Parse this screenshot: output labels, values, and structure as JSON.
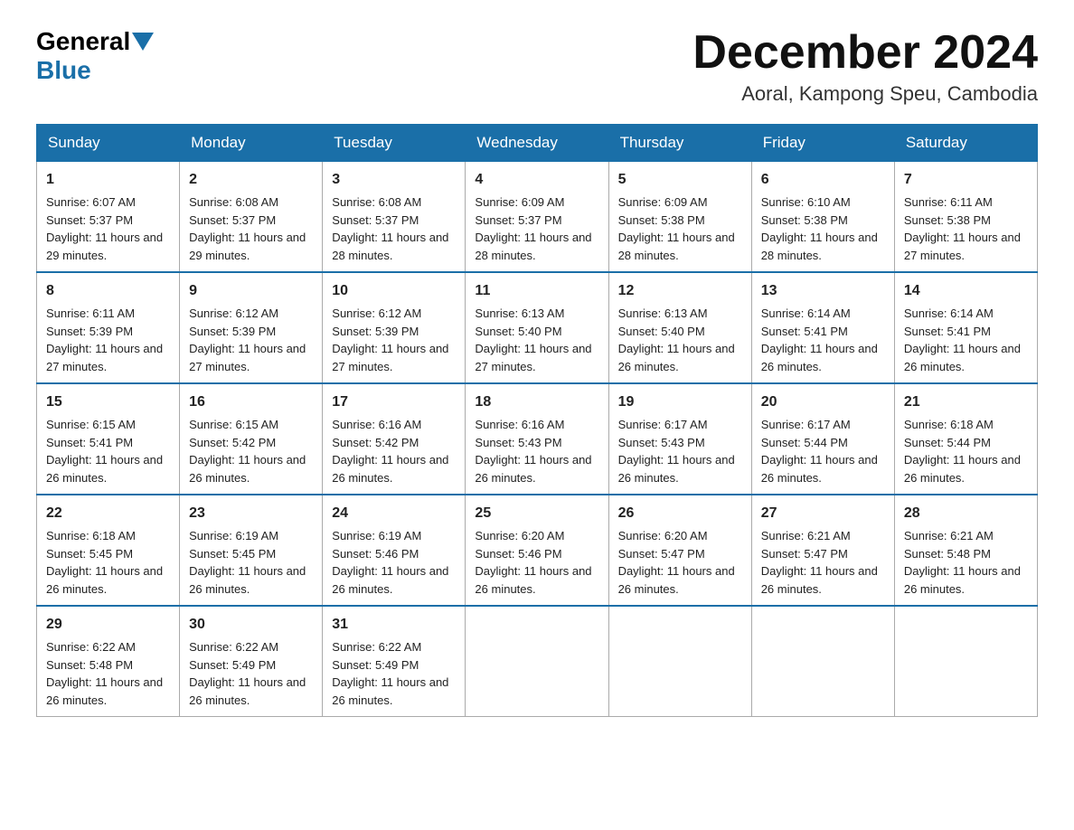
{
  "header": {
    "logo_general": "General",
    "logo_blue": "Blue",
    "month_year": "December 2024",
    "location": "Aoral, Kampong Speu, Cambodia"
  },
  "days_of_week": [
    "Sunday",
    "Monday",
    "Tuesday",
    "Wednesday",
    "Thursday",
    "Friday",
    "Saturday"
  ],
  "weeks": [
    [
      {
        "day": "1",
        "sunrise": "6:07 AM",
        "sunset": "5:37 PM",
        "daylight": "11 hours and 29 minutes."
      },
      {
        "day": "2",
        "sunrise": "6:08 AM",
        "sunset": "5:37 PM",
        "daylight": "11 hours and 29 minutes."
      },
      {
        "day": "3",
        "sunrise": "6:08 AM",
        "sunset": "5:37 PM",
        "daylight": "11 hours and 28 minutes."
      },
      {
        "day": "4",
        "sunrise": "6:09 AM",
        "sunset": "5:37 PM",
        "daylight": "11 hours and 28 minutes."
      },
      {
        "day": "5",
        "sunrise": "6:09 AM",
        "sunset": "5:38 PM",
        "daylight": "11 hours and 28 minutes."
      },
      {
        "day": "6",
        "sunrise": "6:10 AM",
        "sunset": "5:38 PM",
        "daylight": "11 hours and 28 minutes."
      },
      {
        "day": "7",
        "sunrise": "6:11 AM",
        "sunset": "5:38 PM",
        "daylight": "11 hours and 27 minutes."
      }
    ],
    [
      {
        "day": "8",
        "sunrise": "6:11 AM",
        "sunset": "5:39 PM",
        "daylight": "11 hours and 27 minutes."
      },
      {
        "day": "9",
        "sunrise": "6:12 AM",
        "sunset": "5:39 PM",
        "daylight": "11 hours and 27 minutes."
      },
      {
        "day": "10",
        "sunrise": "6:12 AM",
        "sunset": "5:39 PM",
        "daylight": "11 hours and 27 minutes."
      },
      {
        "day": "11",
        "sunrise": "6:13 AM",
        "sunset": "5:40 PM",
        "daylight": "11 hours and 27 minutes."
      },
      {
        "day": "12",
        "sunrise": "6:13 AM",
        "sunset": "5:40 PM",
        "daylight": "11 hours and 26 minutes."
      },
      {
        "day": "13",
        "sunrise": "6:14 AM",
        "sunset": "5:41 PM",
        "daylight": "11 hours and 26 minutes."
      },
      {
        "day": "14",
        "sunrise": "6:14 AM",
        "sunset": "5:41 PM",
        "daylight": "11 hours and 26 minutes."
      }
    ],
    [
      {
        "day": "15",
        "sunrise": "6:15 AM",
        "sunset": "5:41 PM",
        "daylight": "11 hours and 26 minutes."
      },
      {
        "day": "16",
        "sunrise": "6:15 AM",
        "sunset": "5:42 PM",
        "daylight": "11 hours and 26 minutes."
      },
      {
        "day": "17",
        "sunrise": "6:16 AM",
        "sunset": "5:42 PM",
        "daylight": "11 hours and 26 minutes."
      },
      {
        "day": "18",
        "sunrise": "6:16 AM",
        "sunset": "5:43 PM",
        "daylight": "11 hours and 26 minutes."
      },
      {
        "day": "19",
        "sunrise": "6:17 AM",
        "sunset": "5:43 PM",
        "daylight": "11 hours and 26 minutes."
      },
      {
        "day": "20",
        "sunrise": "6:17 AM",
        "sunset": "5:44 PM",
        "daylight": "11 hours and 26 minutes."
      },
      {
        "day": "21",
        "sunrise": "6:18 AM",
        "sunset": "5:44 PM",
        "daylight": "11 hours and 26 minutes."
      }
    ],
    [
      {
        "day": "22",
        "sunrise": "6:18 AM",
        "sunset": "5:45 PM",
        "daylight": "11 hours and 26 minutes."
      },
      {
        "day": "23",
        "sunrise": "6:19 AM",
        "sunset": "5:45 PM",
        "daylight": "11 hours and 26 minutes."
      },
      {
        "day": "24",
        "sunrise": "6:19 AM",
        "sunset": "5:46 PM",
        "daylight": "11 hours and 26 minutes."
      },
      {
        "day": "25",
        "sunrise": "6:20 AM",
        "sunset": "5:46 PM",
        "daylight": "11 hours and 26 minutes."
      },
      {
        "day": "26",
        "sunrise": "6:20 AM",
        "sunset": "5:47 PM",
        "daylight": "11 hours and 26 minutes."
      },
      {
        "day": "27",
        "sunrise": "6:21 AM",
        "sunset": "5:47 PM",
        "daylight": "11 hours and 26 minutes."
      },
      {
        "day": "28",
        "sunrise": "6:21 AM",
        "sunset": "5:48 PM",
        "daylight": "11 hours and 26 minutes."
      }
    ],
    [
      {
        "day": "29",
        "sunrise": "6:22 AM",
        "sunset": "5:48 PM",
        "daylight": "11 hours and 26 minutes."
      },
      {
        "day": "30",
        "sunrise": "6:22 AM",
        "sunset": "5:49 PM",
        "daylight": "11 hours and 26 minutes."
      },
      {
        "day": "31",
        "sunrise": "6:22 AM",
        "sunset": "5:49 PM",
        "daylight": "11 hours and 26 minutes."
      },
      null,
      null,
      null,
      null
    ]
  ]
}
